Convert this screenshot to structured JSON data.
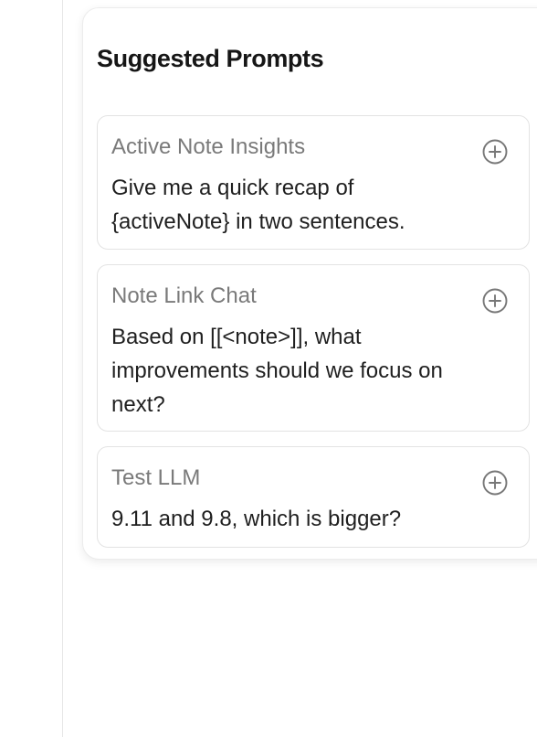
{
  "panel": {
    "title": "Suggested Prompts"
  },
  "prompts": [
    {
      "title": "Active Note Insights",
      "body": "Give me a quick recap of {activeNote} in two sentences.",
      "action_icon": "plus-circle-icon"
    },
    {
      "title": "Note Link Chat",
      "body": "Based on [[<note>]], what improvements should we focus on next?",
      "action_icon": "plus-circle-icon"
    },
    {
      "title": "Test LLM",
      "body": "9.11 and 9.8, which is bigger?",
      "action_icon": "plus-circle-icon"
    }
  ]
}
